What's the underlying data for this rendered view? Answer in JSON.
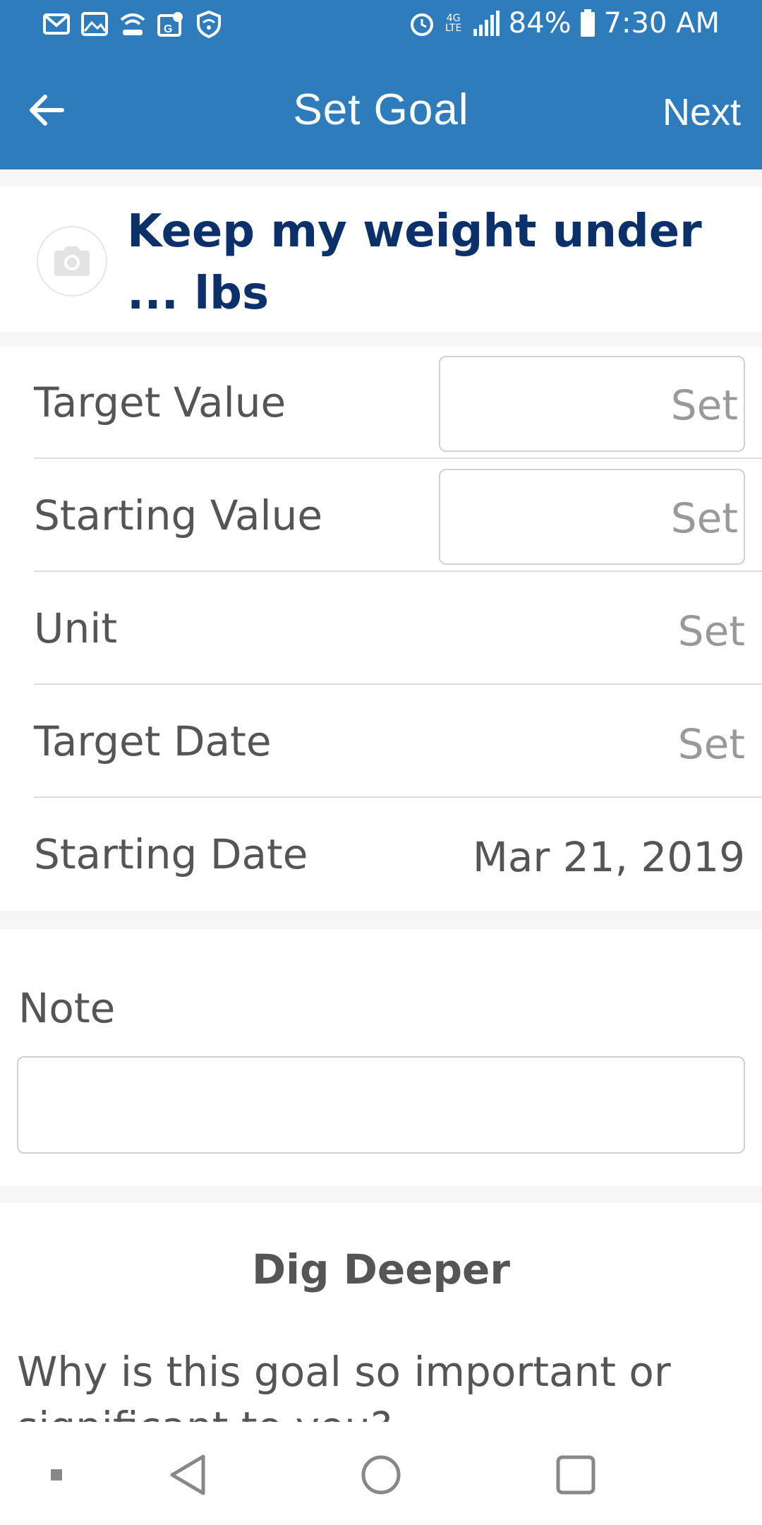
{
  "status_bar": {
    "icons_left": [
      "gmail-icon",
      "gallery-icon",
      "wifi-calling-icon",
      "maps-icon",
      "vpn-shield-icon"
    ],
    "battery": "84%",
    "time": "7:30 AM",
    "network": "4G LTE"
  },
  "app_bar": {
    "title": "Set Goal",
    "next_label": "Next"
  },
  "goal": {
    "title": "Keep my weight under ... lbs"
  },
  "form": {
    "rows": [
      {
        "label": "Target Value",
        "value": "Set"
      },
      {
        "label": "Starting Value",
        "value": "Set"
      },
      {
        "label": "Unit",
        "value": "Set"
      },
      {
        "label": "Target Date",
        "value": "Set"
      },
      {
        "label": "Starting Date",
        "value": "Mar 21, 2019"
      }
    ]
  },
  "note": {
    "label": "Note",
    "value": ""
  },
  "dig_deeper": {
    "title": "Dig Deeper",
    "question": "Why is this goal so important or significant to you?"
  },
  "colors": {
    "primary": "#2f7cbd",
    "goal_title": "#0c3069",
    "text": "#555555",
    "muted": "#999999"
  }
}
